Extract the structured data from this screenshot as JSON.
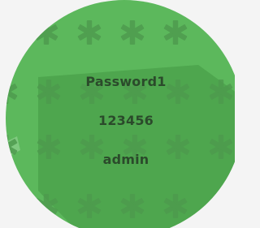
{
  "passwords": [
    "Password1",
    "123456",
    "admin"
  ],
  "colors": {
    "page_background": "#f4f4f4",
    "circle": "#5cb85c",
    "inner_shape": "#4ea64e",
    "asterisk": "#4e9a4e",
    "text": "#2b4a2b"
  },
  "pattern_icon": "asterisk-icon"
}
